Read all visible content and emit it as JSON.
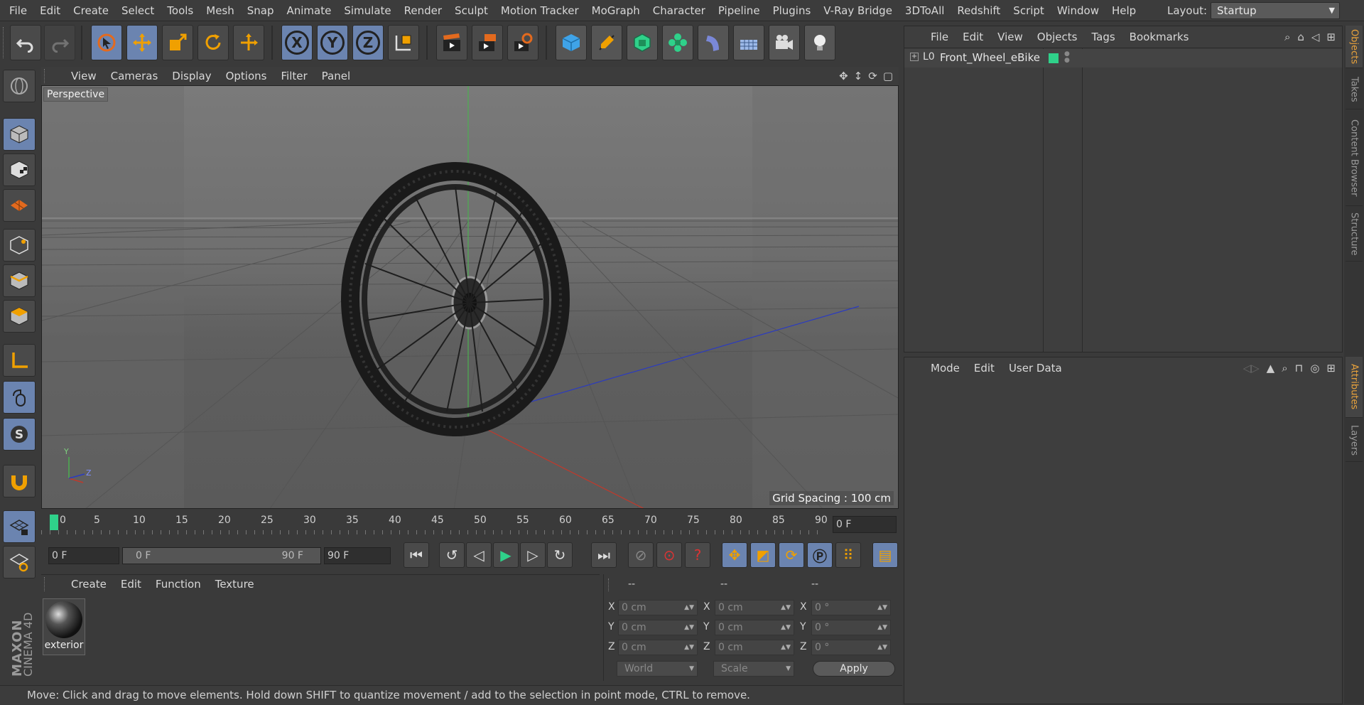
{
  "menubar": {
    "items": [
      "File",
      "Edit",
      "Create",
      "Select",
      "Tools",
      "Mesh",
      "Snap",
      "Animate",
      "Simulate",
      "Render",
      "Sculpt",
      "Motion Tracker",
      "MoGraph",
      "Character",
      "Pipeline",
      "Plugins",
      "V-Ray Bridge",
      "3DToAll",
      "Redshift",
      "Script",
      "Window",
      "Help"
    ],
    "layout_label": "Layout:",
    "layout_value": "Startup"
  },
  "toolbar": {
    "axis_x": "X",
    "axis_y": "Y",
    "axis_z": "Z"
  },
  "viewport": {
    "menu": [
      "View",
      "Cameras",
      "Display",
      "Options",
      "Filter",
      "Panel"
    ],
    "label": "Perspective",
    "grid_spacing": "Grid Spacing : 100 cm",
    "axis_y": "Y",
    "axis_z": "Z"
  },
  "timeline": {
    "ticks": [
      "0",
      "5",
      "10",
      "15",
      "20",
      "25",
      "30",
      "35",
      "40",
      "45",
      "50",
      "55",
      "60",
      "65",
      "70",
      "75",
      "80",
      "85",
      "90"
    ],
    "current_frame": "0 F"
  },
  "controls": {
    "start": "0 F",
    "range_start": "0 F",
    "range_end": "90 F",
    "end": "90 F"
  },
  "material_manager": {
    "menu": [
      "Create",
      "Edit",
      "Function",
      "Texture"
    ],
    "material_name": "exterior"
  },
  "coordinates": {
    "headers": [
      "--",
      "--",
      "--"
    ],
    "rows": [
      {
        "label": "X",
        "pos": "0 cm",
        "size_label": "X",
        "size": "0 cm",
        "rot_label": "X",
        "rot": "0 °"
      },
      {
        "label": "Y",
        "pos": "0 cm",
        "size_label": "Y",
        "size": "0 cm",
        "rot_label": "Y",
        "rot": "0 °"
      },
      {
        "label": "Z",
        "pos": "0 cm",
        "size_label": "Z",
        "size": "0 cm",
        "rot_label": "Z",
        "rot": "0 °"
      }
    ],
    "world": "World",
    "scale": "Scale",
    "apply": "Apply"
  },
  "objects_panel": {
    "menu": [
      "File",
      "Edit",
      "View",
      "Objects",
      "Tags",
      "Bookmarks"
    ],
    "object_name": "Front_Wheel_eBike",
    "layer_color": "#2fd18a"
  },
  "attributes_panel": {
    "menu": [
      "Mode",
      "Edit",
      "User Data"
    ]
  },
  "side_tabs": [
    "Objects",
    "Takes",
    "Content Browser",
    "Structure",
    "Attributes",
    "Layers"
  ],
  "status": "Move: Click and drag to move elements. Hold down SHIFT to quantize movement / add to the selection in point mode, CTRL to remove.",
  "brand": {
    "line1": "MAXON",
    "line2": "CINEMA 4D"
  },
  "colors": {
    "accent": "#6b84b0",
    "highlight": "#e8a23c",
    "playhead": "#2fd18a"
  }
}
